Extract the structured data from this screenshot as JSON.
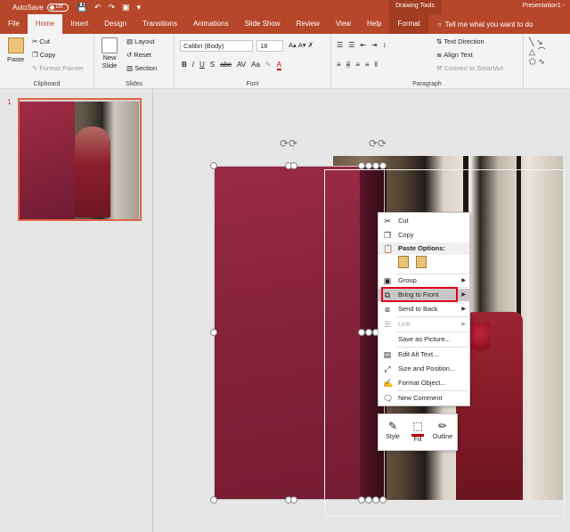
{
  "titlebar": {
    "autosave": "AutoSave",
    "toggle": "Off",
    "drawing_tools": "Drawing Tools",
    "doc_title": "Presentation1 -"
  },
  "tabs": [
    "File",
    "Home",
    "Insert",
    "Design",
    "Transitions",
    "Animations",
    "Slide Show",
    "Review",
    "View",
    "Help"
  ],
  "format_tab": "Format",
  "tellme": "Tell me what you want to do",
  "ribbon": {
    "clipboard": {
      "paste": "Paste",
      "cut": "Cut",
      "copy": "Copy",
      "format_painter": "Format Painter",
      "label": "Clipboard"
    },
    "slides": {
      "new_slide": "New",
      "new_slide2": "Slide",
      "layout": "Layout",
      "reset": "Reset",
      "section": "Section",
      "label": "Slides"
    },
    "font": {
      "name": "Calibri (Body)",
      "size": "18",
      "label": "Font"
    },
    "paragraph": {
      "text_direction": "Text Direction",
      "align_text": "Align Text",
      "convert_smartart": "Convert to SmartArt",
      "label": "Paragraph"
    }
  },
  "thumbs": {
    "slide_number": "1"
  },
  "context_menu": {
    "cut": "Cut",
    "copy": "Copy",
    "paste_options": "Paste Options:",
    "group": "Group",
    "bring_to_front": "Bring to Front",
    "send_to_back": "Send to Back",
    "link": "Link",
    "save_as_picture": "Save as Picture...",
    "edit_alt_text": "Edit Alt Text...",
    "size_position": "Size and Position...",
    "format_object": "Format Object...",
    "new_comment": "New Comment"
  },
  "mini_toolbar": {
    "style": "Style",
    "fill": "Fill",
    "outline": "Outline"
  },
  "colors": {
    "accent": "#b7472a",
    "highlight_box": "#e0001a",
    "shape_fill": "#84223b"
  }
}
